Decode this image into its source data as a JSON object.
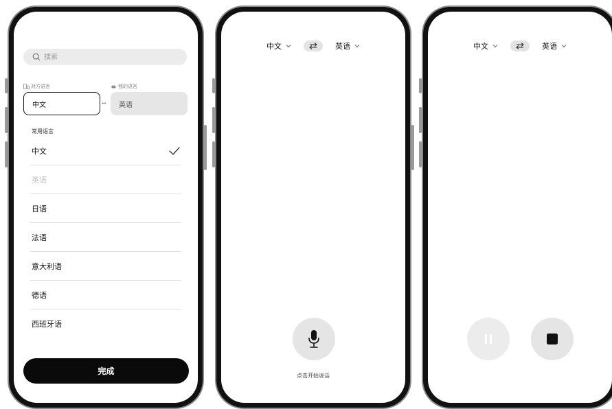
{
  "screen1": {
    "search_placeholder": "搜索",
    "their_language_label": "对方语言",
    "my_language_label": "我的语言",
    "their_language": "中文",
    "my_language": "英语",
    "common_languages_title": "常用语言",
    "languages": [
      {
        "name": "中文",
        "state": "selected"
      },
      {
        "name": "英语",
        "state": "disabled"
      },
      {
        "name": "日语",
        "state": "normal"
      },
      {
        "name": "法语",
        "state": "normal"
      },
      {
        "name": "意大利语",
        "state": "normal"
      },
      {
        "name": "德语",
        "state": "normal"
      },
      {
        "name": "西班牙语",
        "state": "normal"
      }
    ],
    "done_label": "完成"
  },
  "screen2": {
    "source_language": "中文",
    "target_language": "英语",
    "hint": "点击开始说话"
  },
  "screen3": {
    "source_language": "中文",
    "target_language": "英语"
  },
  "icons": {
    "search": "search-icon",
    "check": "check-icon",
    "swap": "swap-icon",
    "chevron": "chevron-down-icon",
    "mic": "microphone-icon",
    "pause": "pause-icon",
    "stop": "stop-icon"
  },
  "colors": {
    "primary": "#0a0a0a",
    "surface": "#ececec",
    "muted_text": "#c4c4c4"
  }
}
